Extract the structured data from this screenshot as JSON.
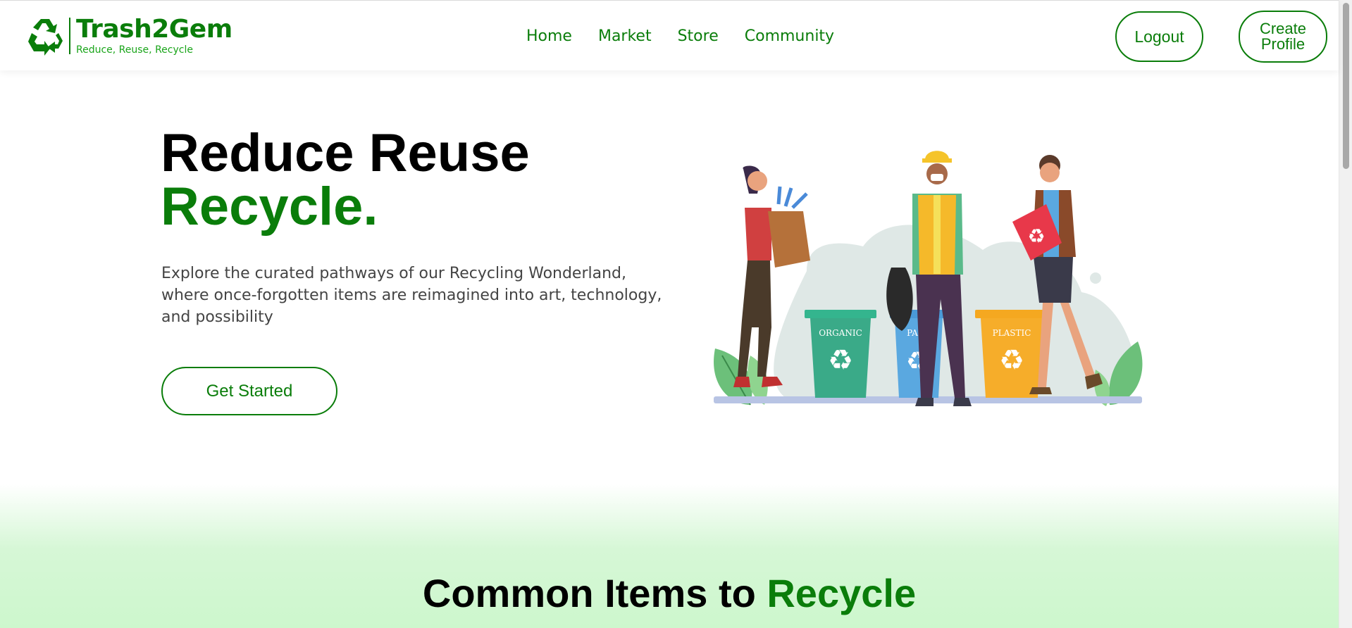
{
  "brand": {
    "title": "Trash2Gem",
    "tagline": "Reduce, Reuse, Recycle",
    "icon": "recycle-icon",
    "color": "#0a7d0a"
  },
  "nav": {
    "links": [
      {
        "label": "Home"
      },
      {
        "label": "Market"
      },
      {
        "label": "Store"
      },
      {
        "label": "Community"
      }
    ],
    "logout_label": "Logout",
    "create_profile_label": "Create\nProfile"
  },
  "hero": {
    "title_line1": "Reduce Reuse",
    "title_line2": "Recycle.",
    "description": "Explore the curated pathways of our Recycling Wonderland, where once-forgotten items are reimagined into art, technology, and possibility",
    "cta_label": "Get Started",
    "illustration": {
      "bins": [
        {
          "label": "ORGANIC",
          "color": "#3aaa88"
        },
        {
          "label": "PA",
          "color": "#5aa8e0"
        },
        {
          "label": "PLASTIC",
          "color": "#f6ad2a"
        }
      ]
    }
  },
  "section": {
    "title_prefix": "Common Items to ",
    "title_accent": "Recycle"
  },
  "colors": {
    "accent": "#0a7d0a",
    "section_bg": "#cdf7cd"
  }
}
